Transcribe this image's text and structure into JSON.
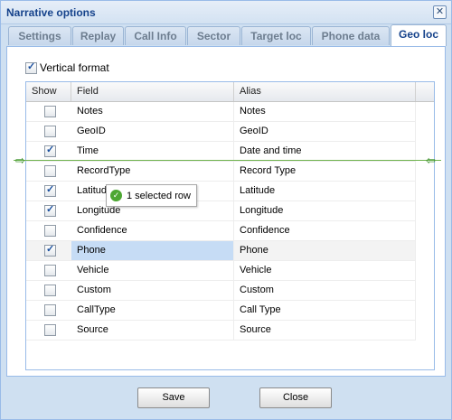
{
  "window": {
    "title": "Narrative options"
  },
  "tabs": [
    {
      "label": "Settings",
      "active": false
    },
    {
      "label": "Replay",
      "active": false
    },
    {
      "label": "Call Info",
      "active": false
    },
    {
      "label": "Sector",
      "active": false
    },
    {
      "label": "Target loc",
      "active": false
    },
    {
      "label": "Phone data",
      "active": false
    },
    {
      "label": "Geo loc",
      "active": true
    }
  ],
  "vertical_format": {
    "label": "Vertical format",
    "checked": true
  },
  "grid": {
    "columns": {
      "show": "Show",
      "field": "Field",
      "alias": "Alias"
    },
    "rows": [
      {
        "show": false,
        "field": "Notes",
        "alias": "Notes"
      },
      {
        "show": false,
        "field": "GeoID",
        "alias": "GeoID"
      },
      {
        "show": true,
        "field": "Time",
        "alias": "Date and time"
      },
      {
        "show": false,
        "field": "RecordType",
        "alias": "Record Type"
      },
      {
        "show": true,
        "field": "Latitude",
        "alias": "Latitude"
      },
      {
        "show": true,
        "field": "Longitude",
        "alias": "Longitude"
      },
      {
        "show": false,
        "field": "Confidence",
        "alias": "Confidence"
      },
      {
        "show": true,
        "field": "Phone",
        "alias": "Phone",
        "selected": true
      },
      {
        "show": false,
        "field": "Vehicle",
        "alias": "Vehicle"
      },
      {
        "show": false,
        "field": "Custom",
        "alias": "Custom"
      },
      {
        "show": false,
        "field": "CallType",
        "alias": "Call Type"
      },
      {
        "show": false,
        "field": "Source",
        "alias": "Source"
      }
    ]
  },
  "drag_tooltip": {
    "text": "1 selected row",
    "icon": "check-circle-icon"
  },
  "buttons": {
    "save": "Save",
    "close": "Close"
  },
  "colors": {
    "accent": "#15428b",
    "selection": "#c6dcf5",
    "drop_indicator": "#6fb34e"
  }
}
